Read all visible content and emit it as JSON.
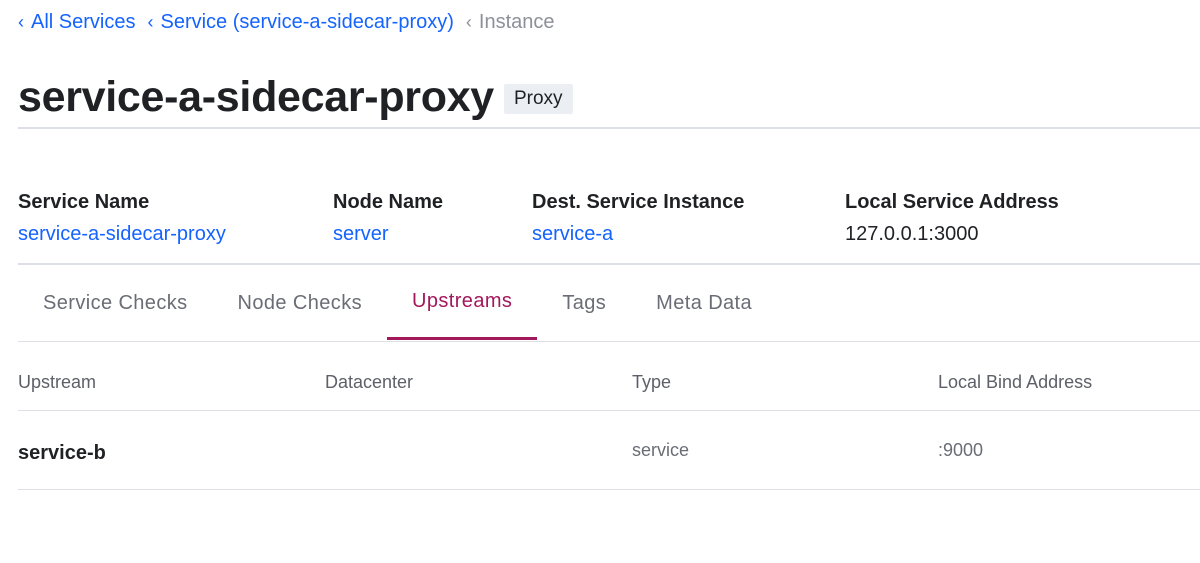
{
  "breadcrumbs": [
    {
      "label": "All Services"
    },
    {
      "label": "Service (service-a-sidecar-proxy)"
    },
    {
      "label": "Instance"
    }
  ],
  "chevron": "‹",
  "page": {
    "title": "service-a-sidecar-proxy",
    "badge": "Proxy"
  },
  "details": [
    {
      "label": "Service Name",
      "value": "service-a-sidecar-proxy",
      "link": true
    },
    {
      "label": "Node Name",
      "value": "server",
      "link": true
    },
    {
      "label": "Dest. Service Instance",
      "value": "service-a",
      "link": true
    },
    {
      "label": "Local Service Address",
      "value": "127.0.0.1:3000",
      "link": false
    }
  ],
  "tabs": [
    {
      "label": "Service Checks"
    },
    {
      "label": "Node Checks"
    },
    {
      "label": "Upstreams",
      "active": true
    },
    {
      "label": "Tags"
    },
    {
      "label": "Meta Data"
    }
  ],
  "table": {
    "columns": [
      "Upstream",
      "Datacenter",
      "Type",
      "Local Bind Address"
    ],
    "rows": [
      {
        "upstream": "service-b",
        "datacenter": "",
        "type": "service",
        "local_bind_address": ":9000"
      }
    ]
  },
  "colors": {
    "link": "#1563ff",
    "active_tab": "#a3185a",
    "muted": "#8c9099"
  }
}
